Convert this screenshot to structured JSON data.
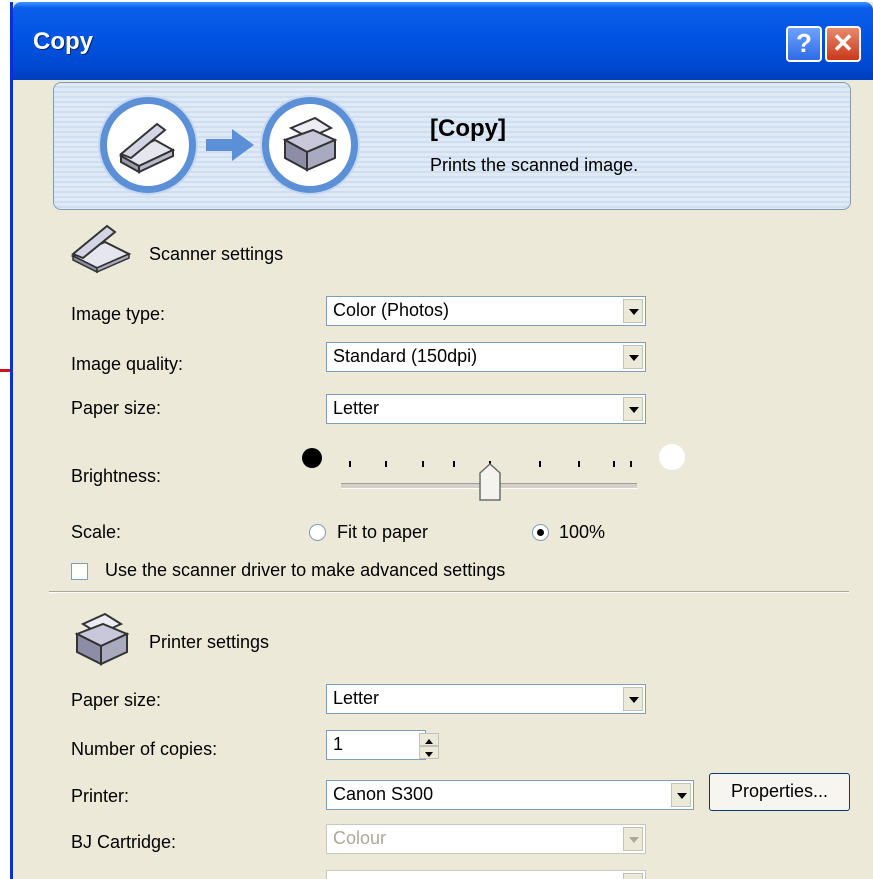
{
  "window": {
    "title": "Copy"
  },
  "banner": {
    "title": "[Copy]",
    "description": "Prints the scanned image."
  },
  "scanner": {
    "heading": "Scanner settings",
    "image_type": {
      "label": "Image type:",
      "value": "Color (Photos)"
    },
    "image_quality": {
      "label": "Image quality:",
      "value": "Standard (150dpi)"
    },
    "paper_size": {
      "label": "Paper size:",
      "value": "Letter"
    },
    "brightness": {
      "label": "Brightness:",
      "level": 0.5
    },
    "scale": {
      "label": "Scale:",
      "options": [
        "Fit to paper",
        "100%"
      ],
      "selected": "100%"
    },
    "advanced": {
      "label": "Use the scanner driver to make advanced settings",
      "checked": false
    }
  },
  "printer": {
    "heading": "Printer settings",
    "paper_size": {
      "label": "Paper size:",
      "value": "Letter"
    },
    "copies": {
      "label": "Number of copies:",
      "value": "1"
    },
    "printer": {
      "label": "Printer:",
      "value": "Canon S300",
      "button": "Properties..."
    },
    "cartridge": {
      "label": "BJ Cartridge:",
      "value": "Colour"
    }
  },
  "colors": {
    "titlebar": "#0054e3",
    "callout": "#d0101a",
    "dialog_bg": "#ece9d8"
  }
}
